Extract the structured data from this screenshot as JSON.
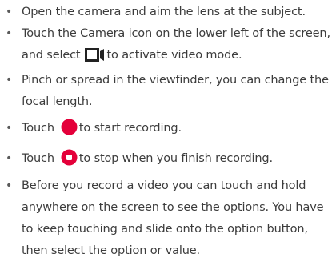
{
  "instructions": {
    "bullet_char": "•",
    "items": [
      {
        "text": "Open the camera and aim the lens at the subject."
      },
      {
        "line1": "Touch the Camera icon on the lower left of the screen,",
        "line2_before": "and select",
        "icon": "video-mode-icon",
        "line2_after": "to activate video mode."
      },
      {
        "line1": "Pinch or spread in the viewfinder, you can change the",
        "line2": "focal length."
      },
      {
        "before": "Touch",
        "icon": "record-icon",
        "after": "to start recording."
      },
      {
        "before": "Touch",
        "icon": "stop-icon",
        "after": "to stop when you finish recording."
      },
      {
        "lines": [
          "Before you record a video you can touch and hold",
          "anywhere on the screen to see the options. You have",
          "to keep touching and slide onto the option button,",
          "then select the option or value."
        ]
      }
    ]
  },
  "colors": {
    "text": "#3c3c3c",
    "record_red": "#e4003a",
    "icon_dark": "#222222"
  }
}
